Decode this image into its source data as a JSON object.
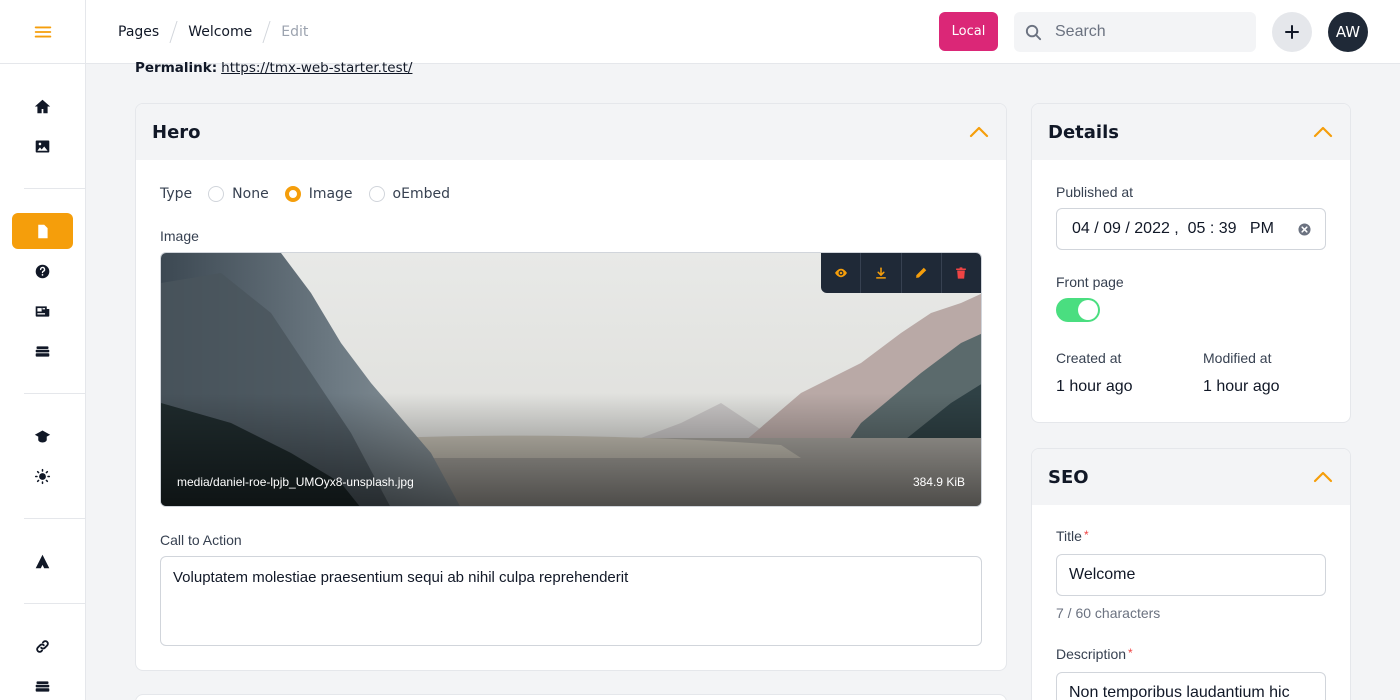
{
  "header": {
    "breadcrumbs": [
      "Pages",
      "Welcome",
      "Edit"
    ],
    "env_badge": "Local",
    "search_placeholder": "Search",
    "avatar_initials": "AW"
  },
  "sidebar": {
    "items": [
      {
        "icon": "home-icon"
      },
      {
        "icon": "image-icon"
      },
      {
        "icon": "page-icon",
        "active": true
      },
      {
        "icon": "question-icon"
      },
      {
        "icon": "news-icon"
      },
      {
        "icon": "stack-icon"
      },
      {
        "icon": "graduation-cap-icon"
      },
      {
        "icon": "lightbulb-icon"
      },
      {
        "icon": "triangle-logo-icon"
      },
      {
        "icon": "link-icon"
      },
      {
        "icon": "stack-icon"
      }
    ]
  },
  "permalink": {
    "label": "Permalink:",
    "url": "https://tmx-web-starter.test/"
  },
  "hero": {
    "title": "Hero",
    "type_label": "Type",
    "type_options": [
      "None",
      "Image",
      "oEmbed"
    ],
    "type_selected": "Image",
    "image_label": "Image",
    "image_filename": "media/daniel-roe-lpjb_UMOyx8-unsplash.jpg",
    "image_size": "384.9 KiB",
    "cta_label": "Call to Action",
    "cta_value": "Voluptatem molestiae praesentium sequi ab nihil culpa reprehenderit"
  },
  "details": {
    "title": "Details",
    "published_label": "Published at",
    "published_value": "04 / 09 / 2022 ,  05 : 39   PM",
    "front_page_label": "Front page",
    "front_page_on": true,
    "created_label": "Created at",
    "created_value": "1 hour ago",
    "modified_label": "Modified at",
    "modified_value": "1 hour ago"
  },
  "seo": {
    "title": "SEO",
    "title_label": "Title",
    "title_value": "Welcome",
    "title_count": "7 / 60 characters",
    "description_label": "Description",
    "description_value": "Non temporibus laudantium hic"
  },
  "colors": {
    "accent": "#f59e0b",
    "env_badge": "#db2777",
    "toggle_on": "#4ade80",
    "delete": "#ef4444"
  }
}
